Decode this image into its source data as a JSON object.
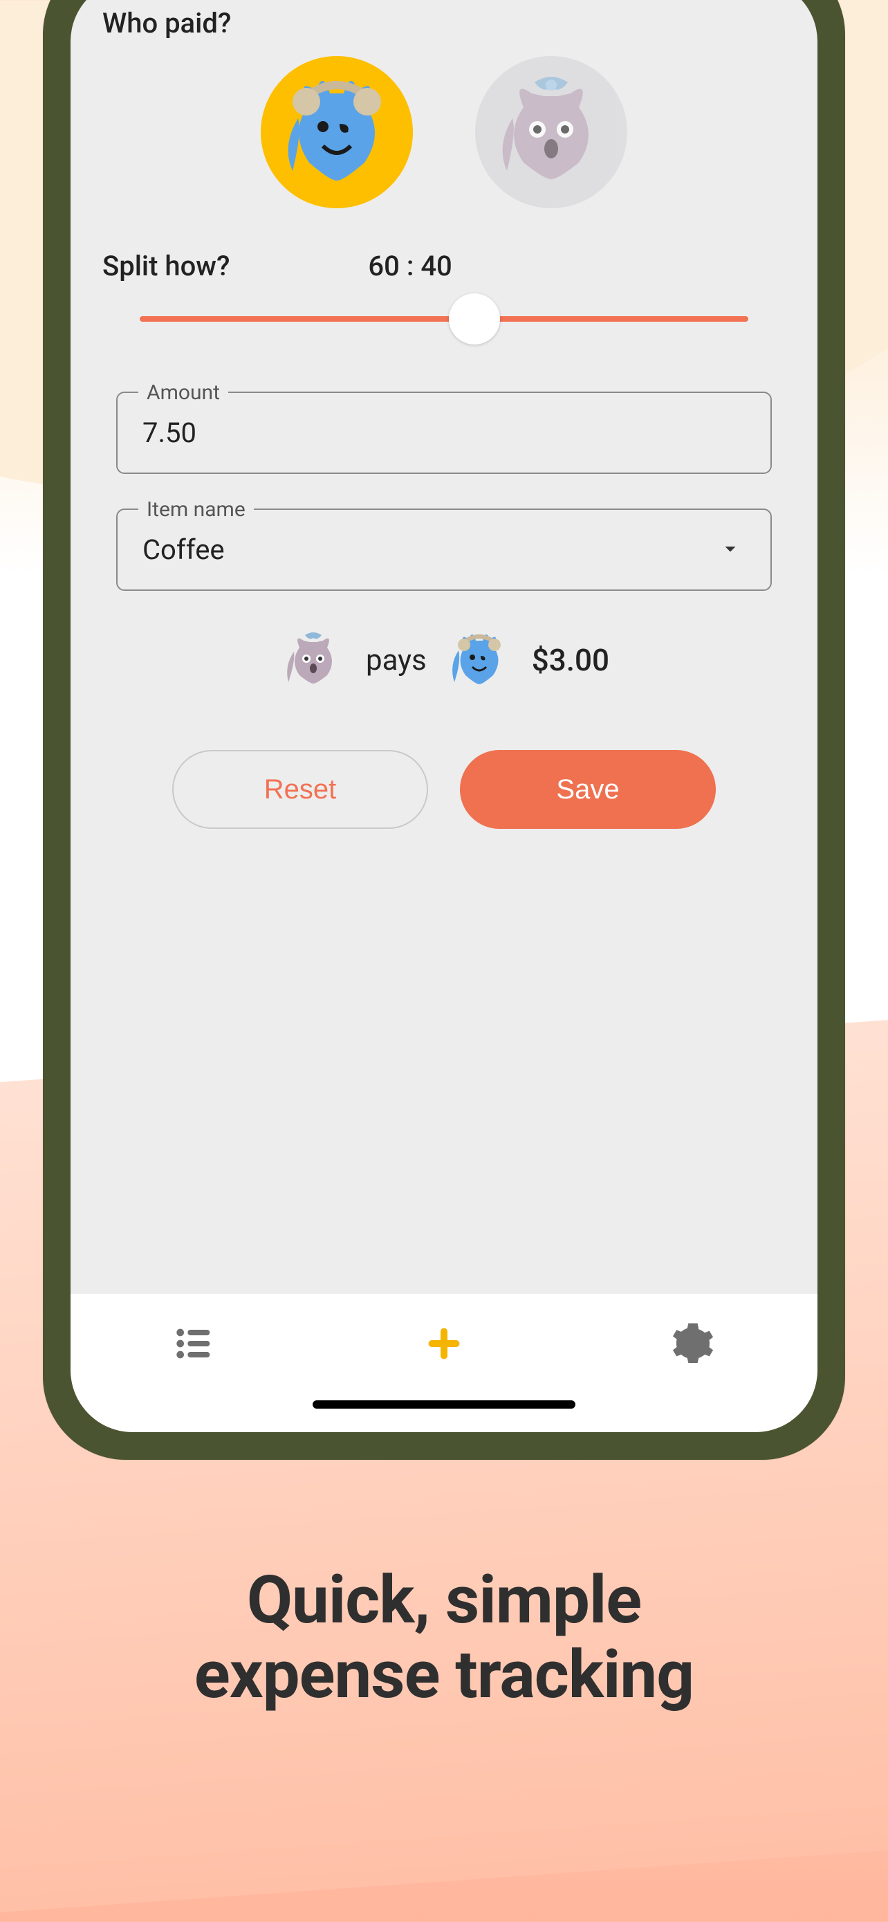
{
  "who_paid_label": "Who paid?",
  "split": {
    "label": "Split how?",
    "ratio": "60 : 40",
    "percent_left": 55
  },
  "amount": {
    "label": "Amount",
    "value": "7.50"
  },
  "item": {
    "label": "Item name",
    "value": "Coffee"
  },
  "pays": {
    "word": "pays",
    "amount": "$3.00"
  },
  "buttons": {
    "reset": "Reset",
    "save": "Save"
  },
  "caption": "Quick, simple\nexpense tracking",
  "colors": {
    "accent": "#f27253",
    "avatar_selected": "#fdbf00",
    "tab_active": "#f5b400"
  }
}
